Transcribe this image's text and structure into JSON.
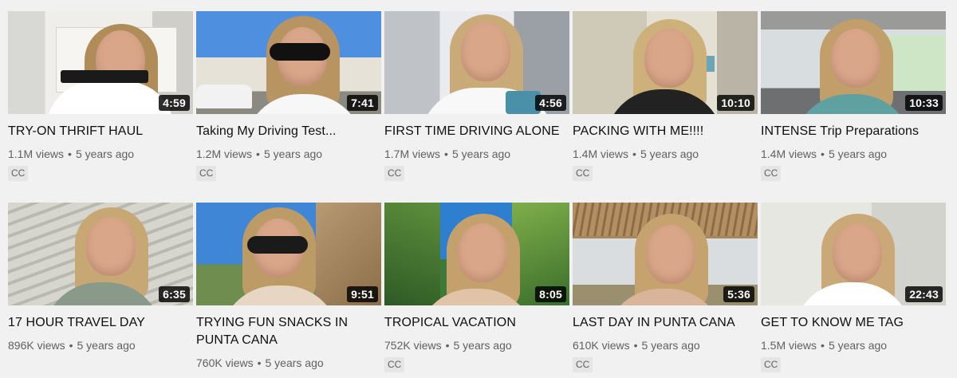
{
  "colors": {
    "page_bg": "#f1f1f1",
    "title_text": "#0f0f0f",
    "meta_text": "#606060",
    "badge_bg": "#e5e5e5",
    "duration_bg": "#000000"
  },
  "videos": [
    {
      "title": "TRY-ON THRIFT HAUL",
      "views": "1.1M views",
      "age": "5 years ago",
      "duration": "4:59",
      "badge": "CC",
      "thumb": "bedroom-dresser"
    },
    {
      "title": "Taking My Driving Test...",
      "views": "1.2M views",
      "age": "5 years ago",
      "duration": "7:41",
      "badge": "CC",
      "thumb": "sunglasses-outdoor"
    },
    {
      "title": "FIRST TIME DRIVING ALONE",
      "views": "1.7M views",
      "age": "5 years ago",
      "duration": "4:56",
      "badge": "CC",
      "thumb": "kitchen"
    },
    {
      "title": "PACKING WITH ME!!!!",
      "views": "1.4M views",
      "age": "5 years ago",
      "duration": "10:10",
      "badge": "CC",
      "thumb": "bedroom"
    },
    {
      "title": "INTENSE Trip Preparations",
      "views": "1.4M views",
      "age": "5 years ago",
      "duration": "10:33",
      "badge": "CC",
      "thumb": "car"
    },
    {
      "title": "17 HOUR TRAVEL DAY",
      "views": "896K views",
      "age": "5 years ago",
      "duration": "6:35",
      "badge": "",
      "thumb": "airport"
    },
    {
      "title": "TRYING FUN SNACKS IN PUNTA CANA",
      "views": "760K views",
      "age": "5 years ago",
      "duration": "9:51",
      "badge": "",
      "thumb": "beach-palms"
    },
    {
      "title": "TROPICAL VACATION",
      "views": "752K views",
      "age": "5 years ago",
      "duration": "8:05",
      "badge": "CC",
      "thumb": "palm-sky"
    },
    {
      "title": "LAST DAY IN PUNTA CANA",
      "views": "610K views",
      "age": "5 years ago",
      "duration": "5:36",
      "badge": "CC",
      "thumb": "palapa"
    },
    {
      "title": "GET TO KNOW ME TAG",
      "views": "1.5M views",
      "age": "5 years ago",
      "duration": "22:43",
      "badge": "CC",
      "thumb": "white-room"
    }
  ]
}
